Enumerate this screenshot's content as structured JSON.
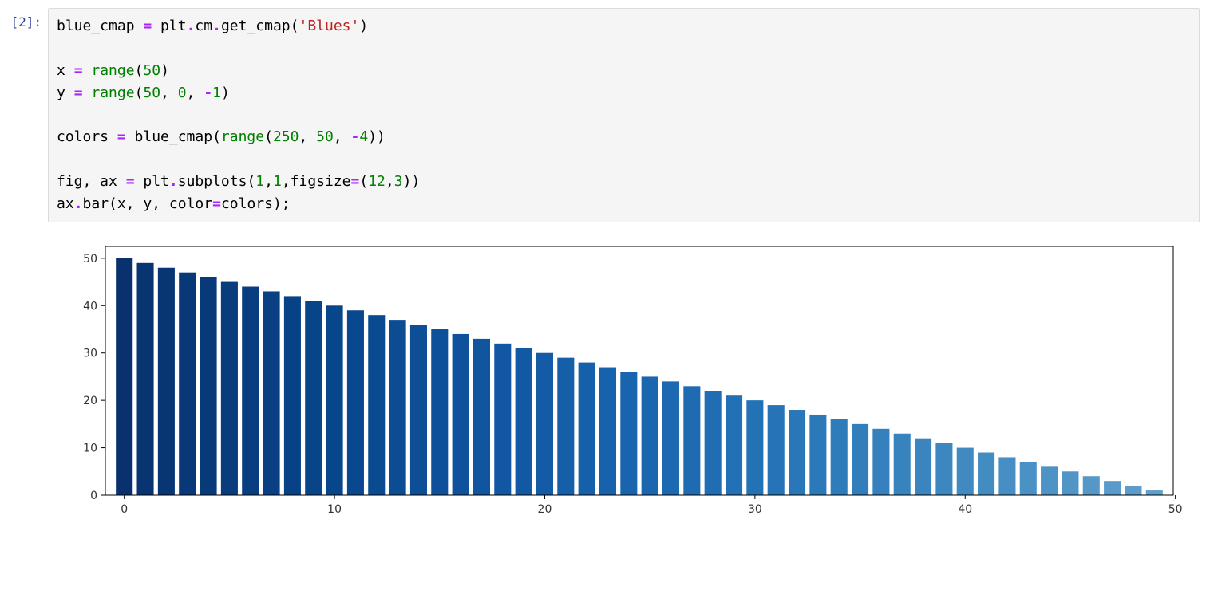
{
  "prompt": {
    "open": "[",
    "num": "2",
    "close": "]:"
  },
  "code": {
    "l1": {
      "a": "blue_cmap ",
      "b": "=",
      "c": " plt",
      "d": ".",
      "e": "cm",
      "f": ".",
      "g": "get_cmap(",
      "h": "'Blues'",
      "i": ")"
    },
    "l3": {
      "a": "x ",
      "b": "=",
      "c": " ",
      "d": "range",
      "e": "(",
      "f": "50",
      "g": ")"
    },
    "l4": {
      "a": "y ",
      "b": "=",
      "c": " ",
      "d": "range",
      "e": "(",
      "f": "50",
      "g": ", ",
      "h": "0",
      "i": ", ",
      "j": "-",
      "k": "1",
      "l": ")"
    },
    "l6": {
      "a": "colors ",
      "b": "=",
      "c": " blue_cmap(",
      "d": "range",
      "e": "(",
      "f": "250",
      "g": ", ",
      "h": "50",
      "i": ", ",
      "j": "-",
      "k": "4",
      "l": "))"
    },
    "l8": {
      "a": "fig, ax ",
      "b": "=",
      "c": " plt",
      "d": ".",
      "e": "subplots(",
      "f": "1",
      "g": ",",
      "h": "1",
      "i": ",figsize",
      "j": "=",
      "k": "(",
      "l": "12",
      "m": ",",
      "n": "3",
      "o": "))"
    },
    "l9": {
      "a": "ax",
      "b": ".",
      "c": "bar(x, y, color",
      "d": "=",
      "e": "colors);"
    }
  },
  "chart_data": {
    "type": "bar",
    "x": [
      0,
      1,
      2,
      3,
      4,
      5,
      6,
      7,
      8,
      9,
      10,
      11,
      12,
      13,
      14,
      15,
      16,
      17,
      18,
      19,
      20,
      21,
      22,
      23,
      24,
      25,
      26,
      27,
      28,
      29,
      30,
      31,
      32,
      33,
      34,
      35,
      36,
      37,
      38,
      39,
      40,
      41,
      42,
      43,
      44,
      45,
      46,
      47,
      48,
      49
    ],
    "y": [
      50,
      49,
      48,
      47,
      46,
      45,
      44,
      43,
      42,
      41,
      40,
      39,
      38,
      37,
      36,
      35,
      34,
      33,
      32,
      31,
      30,
      29,
      28,
      27,
      26,
      25,
      24,
      23,
      22,
      21,
      20,
      19,
      18,
      17,
      16,
      15,
      14,
      13,
      12,
      11,
      10,
      9,
      8,
      7,
      6,
      5,
      4,
      3,
      2,
      1
    ],
    "colors": [
      "#08316e",
      "#083471",
      "#083674",
      "#083877",
      "#083a7a",
      "#083c7d",
      "#083e80",
      "#084083",
      "#084286",
      "#084488",
      "#08468b",
      "#09488e",
      "#0a4a91",
      "#0b4c93",
      "#0d4e96",
      "#0e5099",
      "#0f529b",
      "#10559e",
      "#1157a1",
      "#1259a3",
      "#135ba6",
      "#155ea8",
      "#1660ab",
      "#1762ac",
      "#1864ae",
      "#1a66af",
      "#1c69b1",
      "#1e6bb2",
      "#206db4",
      "#2270b5",
      "#2472b6",
      "#2674b7",
      "#2977b8",
      "#2c79b9",
      "#2f7cba",
      "#327ebb",
      "#3580bd",
      "#3783be",
      "#3a85bf",
      "#3d87c0",
      "#408ac1",
      "#438cc2",
      "#478ec4",
      "#4a91c5",
      "#4e93c6",
      "#5195c7",
      "#5598c8",
      "#589ac9",
      "#5c9cca",
      "#5f9fcb"
    ],
    "xticks": [
      0,
      10,
      20,
      30,
      40,
      50
    ],
    "yticks": [
      0,
      10,
      20,
      30,
      40,
      50
    ],
    "xlim": [
      -0.9,
      49.9
    ],
    "ylim": [
      0,
      52.5
    ],
    "title": "",
    "xlabel": "",
    "ylabel": ""
  },
  "ticklabels": {
    "x0": "0",
    "x1": "10",
    "x2": "20",
    "x3": "30",
    "x4": "40",
    "x5": "50",
    "y0": "0",
    "y1": "10",
    "y2": "20",
    "y3": "30",
    "y4": "40",
    "y5": "50"
  }
}
